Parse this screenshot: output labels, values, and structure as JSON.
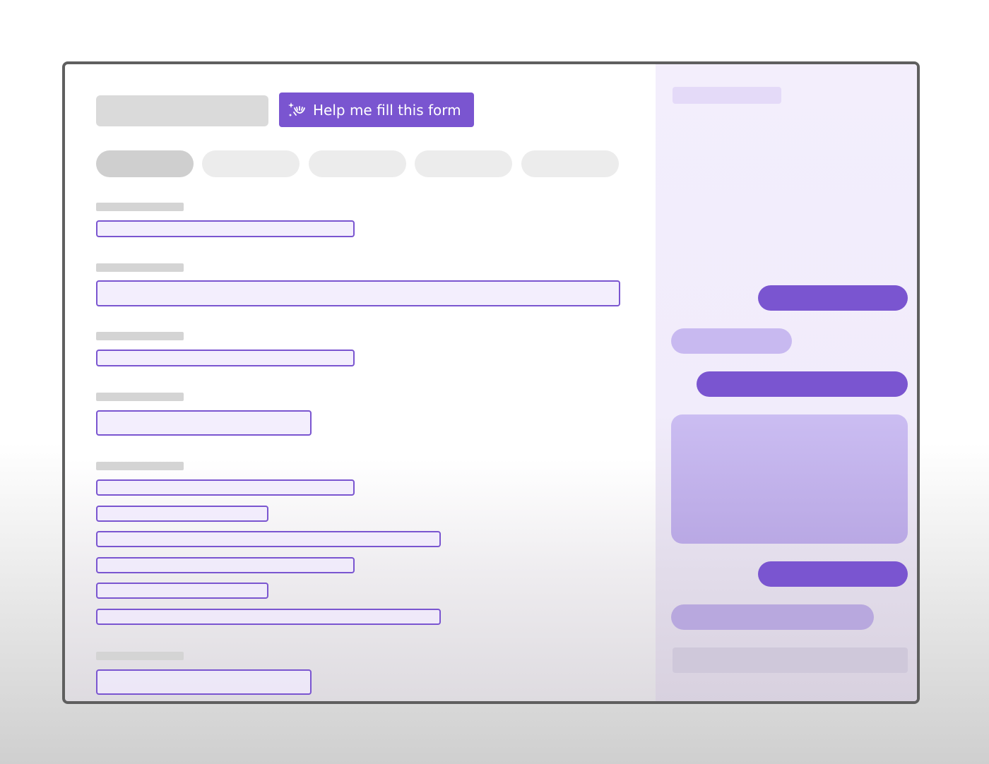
{
  "form_header": {
    "help_button_label": "Help me fill this form",
    "help_button_icon": "sparkle-hand-icon"
  },
  "tabs": {
    "count": 5,
    "active_index": 0
  },
  "colors": {
    "accent": "#7a55d0",
    "accent_light": "#c8b9f0",
    "panel_background": "#f3eefc",
    "placeholder": "#dadada"
  }
}
